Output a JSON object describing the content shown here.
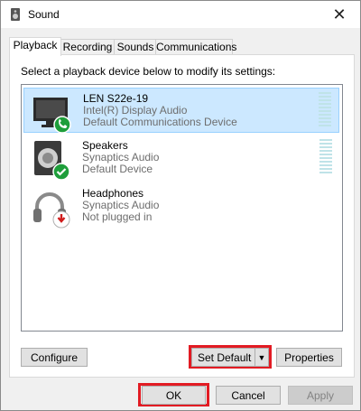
{
  "window": {
    "title": "Sound",
    "close_glyph": "✕"
  },
  "tabs": [
    {
      "label": "Playback",
      "active": true
    },
    {
      "label": "Recording",
      "active": false
    },
    {
      "label": "Sounds",
      "active": false
    },
    {
      "label": "Communications",
      "active": false
    }
  ],
  "playback": {
    "instructions": "Select a playback device below to modify its settings:",
    "devices": [
      {
        "name": "LEN S22e-19",
        "line1": "Intel(R) Display Audio",
        "line2": "Default Communications Device",
        "icon": "monitor-icon",
        "badge": "phone-badge-icon",
        "selected": true
      },
      {
        "name": "Speakers",
        "line1": "Synaptics Audio",
        "line2": "Default Device",
        "icon": "speaker-icon",
        "badge": "check-badge-icon",
        "selected": false
      },
      {
        "name": "Headphones",
        "line1": "Synaptics Audio",
        "line2": "Not plugged in",
        "icon": "headphones-icon",
        "badge": "unplugged-badge-icon",
        "selected": false
      }
    ]
  },
  "buttons": {
    "configure": "Configure",
    "set_default": "Set Default",
    "properties": "Properties",
    "ok": "OK",
    "cancel": "Cancel",
    "apply": "Apply"
  },
  "colors": {
    "selection": "#cce8ff",
    "highlight": "#e21b23",
    "badge_green": "#1e9e3b",
    "badge_red": "#d01c1c"
  }
}
